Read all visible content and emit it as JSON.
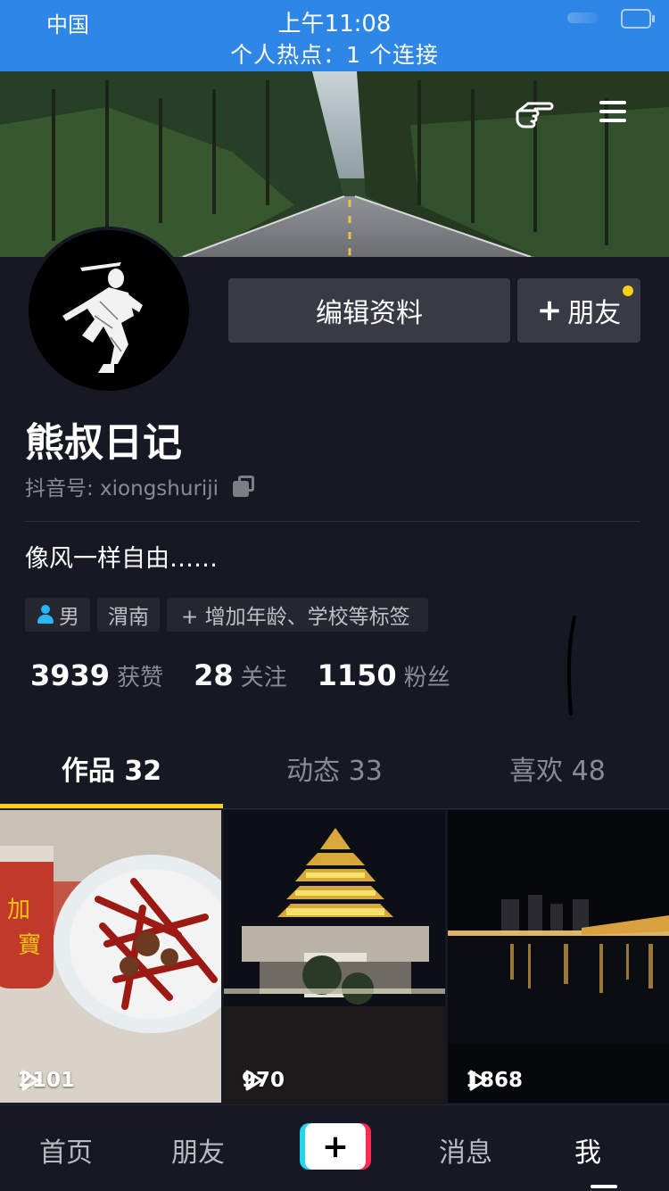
{
  "status_bar": {
    "carrier": "中国",
    "time": "上午11:08",
    "hotspot": "个人热点：1 个连接"
  },
  "header": {
    "icons": [
      "hand-pointer-icon",
      "hamburger-menu-icon"
    ]
  },
  "profile": {
    "edit_button": "编辑资料",
    "add_friend_button": "朋友",
    "add_friend_plus": "+",
    "username": "熊叔日记",
    "douyin_id": "抖音号: xiongshuriji",
    "bio": "像风一样自由……",
    "tags": {
      "gender": "男",
      "location": "渭南",
      "add_tags": "+ 增加年龄、学校等标签"
    },
    "stats": [
      {
        "num": "3939",
        "label": "获赞"
      },
      {
        "num": "28",
        "label": "关注"
      },
      {
        "num": "1150",
        "label": "粉丝"
      }
    ]
  },
  "tabs": [
    {
      "label": "作品 32",
      "active": true
    },
    {
      "label": "动态 33",
      "active": false
    },
    {
      "label": "喜欢 48",
      "active": false
    }
  ],
  "videos": [
    {
      "plays": "2101"
    },
    {
      "plays": "970"
    },
    {
      "plays": "1868"
    }
  ],
  "bottom_nav": {
    "home": "首页",
    "friends": "朋友",
    "create": "+",
    "messages": "消息",
    "me": "我"
  },
  "colors": {
    "background": "#161823",
    "status_bar": "#2e86e6",
    "accent_yellow": "#face15",
    "button_bg": "#393b44",
    "muted_text": "#8a8b91"
  }
}
